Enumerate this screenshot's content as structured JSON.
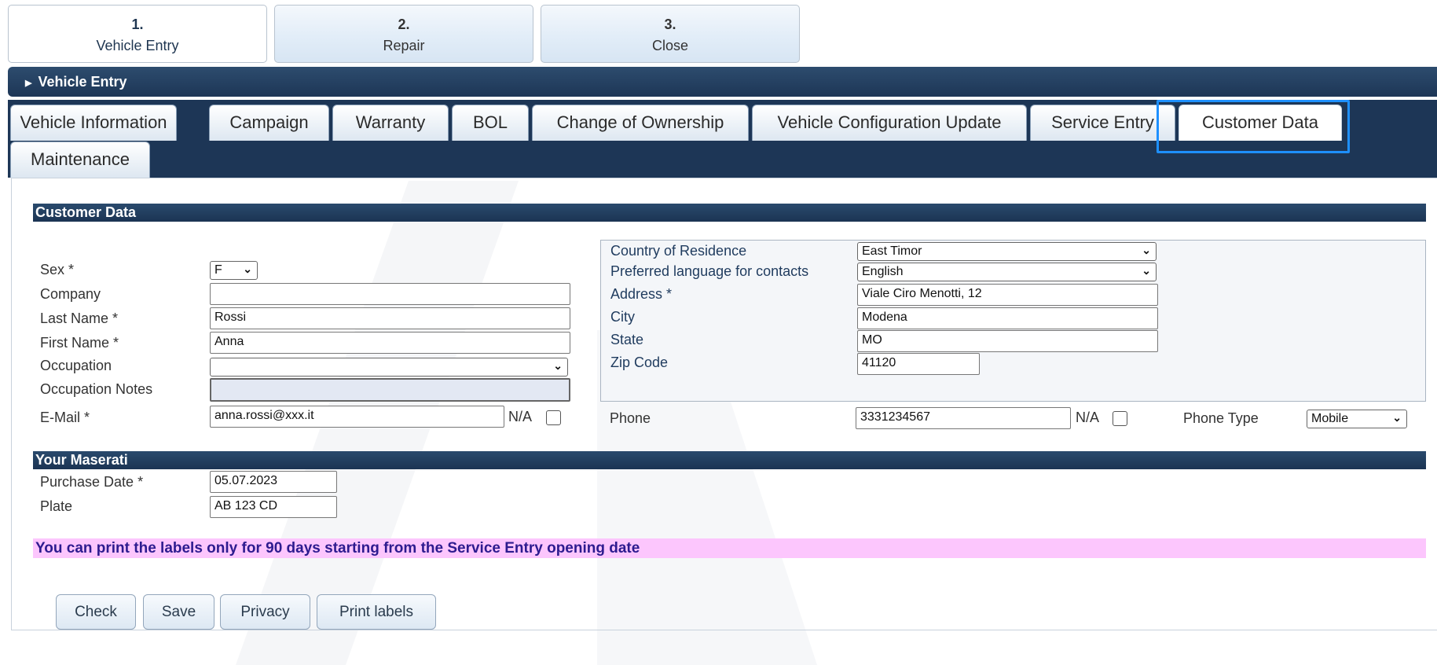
{
  "steps": [
    {
      "num": "1.",
      "label": "Vehicle Entry"
    },
    {
      "num": "2.",
      "label": "Repair"
    },
    {
      "num": "3.",
      "label": "Close"
    }
  ],
  "section": {
    "title": "Vehicle Entry"
  },
  "tabs": [
    "Vehicle Information",
    "Campaign",
    "Warranty",
    "BOL",
    "Change of Ownership",
    "Vehicle Configuration Update",
    "Service Entry",
    "Customer Data",
    "Maintenance"
  ],
  "active_tab": "Customer Data",
  "customer": {
    "title": "Customer Data",
    "sex_label": "Sex *",
    "sex_value": "F",
    "company_label": "Company",
    "company_value": "",
    "last_name_label": "Last Name *",
    "last_name_value": "Rossi",
    "first_name_label": "First Name *",
    "first_name_value": "Anna",
    "occupation_label": "Occupation",
    "occupation_value": "",
    "occupation_notes_label": "Occupation Notes",
    "occupation_notes_value": "",
    "email_label": "E-Mail *",
    "email_value": "anna.rossi@xxx.it",
    "email_na_label": "N/A",
    "country_label": "Country of Residence",
    "country_value": "East Timor",
    "language_label": "Preferred language for contacts",
    "language_value": "English",
    "address_label": "Address *",
    "address_value": "Viale Ciro Menotti, 12",
    "city_label": "City",
    "city_value": "Modena",
    "state_label": "State",
    "state_value": "MO",
    "zip_label": "Zip Code",
    "zip_value": "41120",
    "phone_label": "Phone",
    "phone_value": "3331234567",
    "phone_na_label": "N/A",
    "phone_type_label": "Phone Type",
    "phone_type_value": "Mobile"
  },
  "maserati": {
    "title": "Your Maserati",
    "purchase_date_label": "Purchase Date *",
    "purchase_date_value": "05.07.2023",
    "plate_label": "Plate",
    "plate_value": "AB 123 CD"
  },
  "note": "You can print the labels only for 90 days starting from the Service Entry opening date",
  "buttons": {
    "check": "Check",
    "save": "Save",
    "privacy": "Privacy",
    "print_labels": "Print labels"
  }
}
